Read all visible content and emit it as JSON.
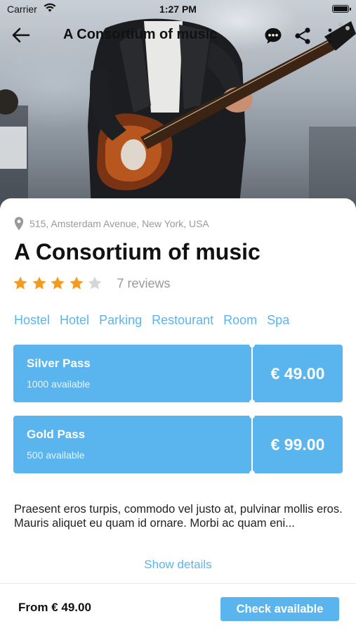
{
  "status_bar": {
    "carrier": "Carrier",
    "time": "1:27 PM"
  },
  "nav": {
    "title": "A Consortium of music"
  },
  "event": {
    "address": "515, Amsterdam Avenue, New York, USA",
    "title": "A Consortium of music",
    "rating": 4,
    "rating_max": 5,
    "reviews": "7 reviews"
  },
  "tags": [
    "Hostel",
    "Hotel",
    "Parking",
    "Restourant",
    "Room",
    "Spa"
  ],
  "passes": [
    {
      "name": "Silver Pass",
      "availability": "1000 available",
      "price": "€ 49.00"
    },
    {
      "name": "Gold Pass",
      "availability": "500 available",
      "price": "€ 99.00"
    }
  ],
  "description": "Praesent eros turpis, commodo vel justo at, pulvinar mollis eros. Mauris aliquet eu quam id ornare. Morbi ac quam eni...",
  "show_details": "Show details",
  "footer": {
    "from_price": "From € 49.00",
    "check_button": "Check available"
  },
  "colors": {
    "accent": "#5ab4ee",
    "star_filled": "#f59a1e",
    "star_empty": "#d6d6d6",
    "muted_text": "#9a9a9a"
  }
}
